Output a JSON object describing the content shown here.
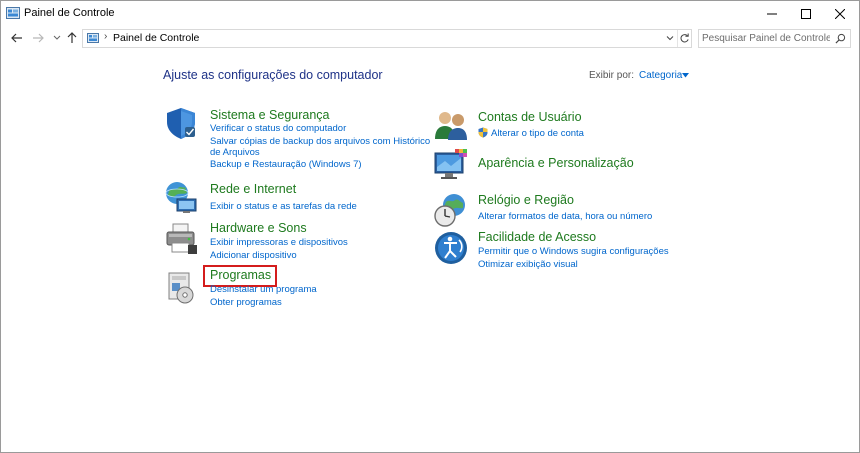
{
  "window": {
    "title": "Painel de Controle",
    "controls": {
      "minimize": "minimize-icon",
      "maximize": "maximize-icon",
      "close": "close-icon"
    }
  },
  "address": {
    "separator": "›",
    "breadcrumb": "Painel de Controle",
    "search_placeholder": "Pesquisar Painel de Controle"
  },
  "main": {
    "title": "Ajuste as configurações do computador",
    "view_by_label": "Exibir por:",
    "view_by_value": "Categoria"
  },
  "left_categories": [
    {
      "title": "Sistema e Segurança",
      "icon": "shield-icon",
      "links": [
        "Verificar o status do computador",
        "Salvar cópias de backup dos arquivos com Histórico",
        "de Arquivos",
        "Backup e Restauração (Windows 7)"
      ]
    },
    {
      "title": "Rede e Internet",
      "icon": "network-icon",
      "links": [
        "Exibir o status e as tarefas da rede"
      ]
    },
    {
      "title": "Hardware e Sons",
      "icon": "printer-icon",
      "links": [
        "Exibir impressoras e dispositivos",
        "Adicionar dispositivo"
      ]
    },
    {
      "title": "Programas",
      "icon": "programs-icon",
      "links": [
        "Desinstalar um programa",
        "Obter programas"
      ]
    }
  ],
  "right_categories": [
    {
      "title": "Contas de Usuário",
      "icon": "users-icon",
      "links": [
        "Alterar o tipo de conta"
      ]
    },
    {
      "title": "Aparência e Personalização",
      "icon": "monitor-icon",
      "links": []
    },
    {
      "title": "Relógio e Região",
      "icon": "clock-icon",
      "links": [
        "Alterar formatos de data, hora ou número"
      ]
    },
    {
      "title": "Facilidade de Acesso",
      "icon": "accessibility-icon",
      "links": [
        "Permitir que o Windows sugira configurações",
        "Otimizar exibição visual"
      ]
    }
  ],
  "colors": {
    "category_title": "#1e7a1e",
    "link": "#0066cc",
    "page_title": "#1e3287",
    "highlight_border": "#d41c1c"
  }
}
